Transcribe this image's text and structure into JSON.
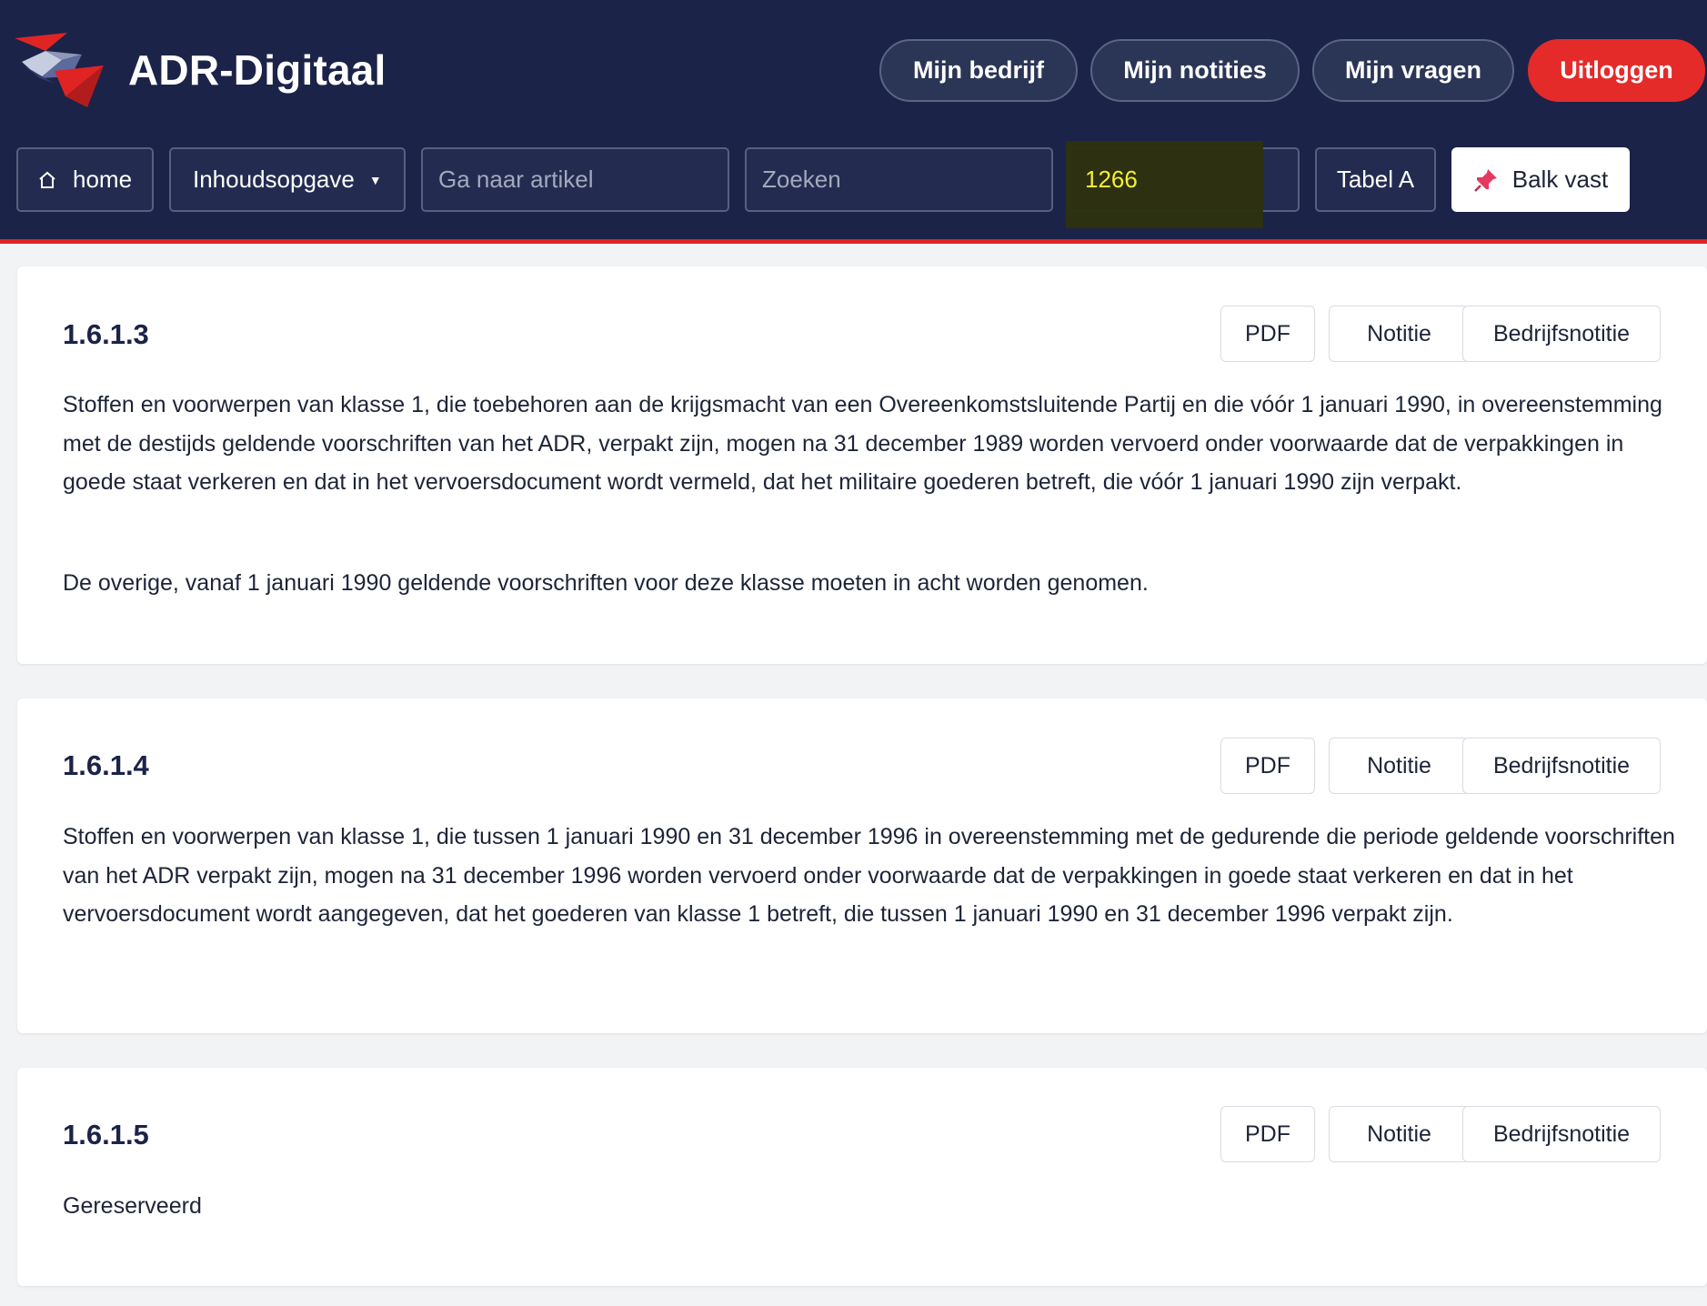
{
  "header": {
    "brand": "ADR-Digitaal",
    "nav": {
      "company": "Mijn bedrijf",
      "notes": "Mijn notities",
      "questions": "Mijn vragen",
      "logout": "Uitloggen"
    },
    "colors": {
      "header_bg": "#1b2348",
      "accent_red": "#e02424",
      "logout_bg": "#e52a2a",
      "highlight_text": "#f6f033"
    }
  },
  "toolbar": {
    "home_label": "home",
    "home_icon": "home-icon",
    "toc_label": "Inhoudsopgave",
    "goto_placeholder": "Ga naar artikel",
    "search_placeholder": "Zoeken",
    "un_number_value": "1266",
    "table_label": "Tabel A",
    "pin_label": "Balk vast",
    "pin_icon": "pushpin-icon"
  },
  "articles": [
    {
      "number": "1.6.1.3",
      "buttons": {
        "pdf": "PDF",
        "note": "Notitie",
        "company_note": "Bedrijfsnotitie"
      },
      "paragraphs": [
        "Stoffen en voorwerpen van klasse 1, die toebehoren aan de krijgsmacht van een Overeenkomstsluitende Partij en die vóór 1 januari 1990, in overeenstemming met de destijds geldende voorschriften van het ADR, verpakt zijn, mogen na 31 december 1989 worden vervoerd onder voorwaarde dat de verpakkingen in goede staat verkeren en dat in het vervoersdocument wordt vermeld, dat het militaire goederen betreft, die vóór 1 januari 1990 zijn verpakt.",
        "De overige, vanaf 1 januari 1990 geldende voorschriften voor deze klasse moeten in acht worden genomen."
      ]
    },
    {
      "number": "1.6.1.4",
      "buttons": {
        "pdf": "PDF",
        "note": "Notitie",
        "company_note": "Bedrijfsnotitie"
      },
      "paragraphs": [
        "Stoffen en voorwerpen van klasse 1, die tussen 1 januari 1990 en 31 december 1996 in overeenstemming met de gedurende die periode geldende voorschriften van het ADR verpakt zijn, mogen na 31 december 1996 worden vervoerd onder voorwaarde dat de verpakkingen in goede staat verkeren en dat in het vervoersdocument wordt aangegeven, dat het goederen van klasse 1 betreft, die tussen 1 januari 1990 en 31 december 1996 verpakt zijn."
      ]
    },
    {
      "number": "1.6.1.5",
      "buttons": {
        "pdf": "PDF",
        "note": "Notitie",
        "company_note": "Bedrijfsnotitie"
      },
      "paragraphs": [
        "Gereserveerd"
      ]
    }
  ]
}
